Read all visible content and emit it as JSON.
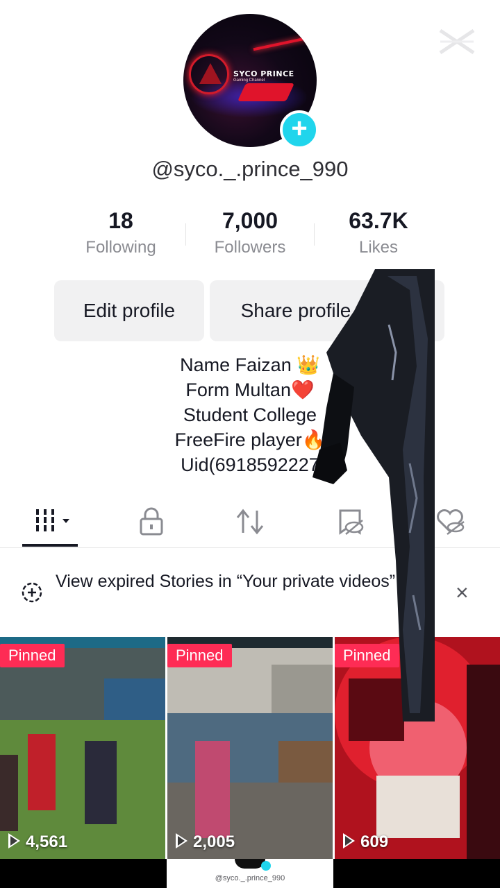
{
  "profile": {
    "avatar_brand": "SYCO PRINCE",
    "avatar_brand_sub": "Gaming Channel",
    "username": "@syco._.prince_990"
  },
  "stats": [
    {
      "value": "18",
      "label": "Following"
    },
    {
      "value": "7,000",
      "label": "Followers"
    },
    {
      "value": "63.7K",
      "label": "Likes"
    }
  ],
  "buttons": {
    "edit": "Edit profile",
    "share": "Share profile"
  },
  "bio": [
    "Name Faizan 👑",
    "Form Multan❤️",
    "Student College",
    "FreeFire player🔥",
    "Uid(6918592227"
  ],
  "tabs": [
    {
      "icon": "grid-icon",
      "active": true
    },
    {
      "icon": "lock-icon",
      "active": false
    },
    {
      "icon": "repost-icon",
      "active": false
    },
    {
      "icon": "hidden-favorites-icon",
      "active": false
    },
    {
      "icon": "hidden-liked-icon",
      "active": false
    }
  ],
  "notice": {
    "text": "View expired Stories in “Your private videos”"
  },
  "videos": [
    {
      "badge": "Pinned",
      "views": "4,561"
    },
    {
      "badge": "Pinned",
      "views": "2,005"
    },
    {
      "badge": "Pinned",
      "views": "609"
    }
  ],
  "watermark": {
    "handle": "@syco._.prince_990"
  },
  "colors": {
    "accent_pink": "#fe2c55",
    "accent_cyan": "#20d5ec",
    "text_primary": "#161823",
    "text_secondary": "#8a8b91",
    "button_bg": "#f1f1f2"
  }
}
